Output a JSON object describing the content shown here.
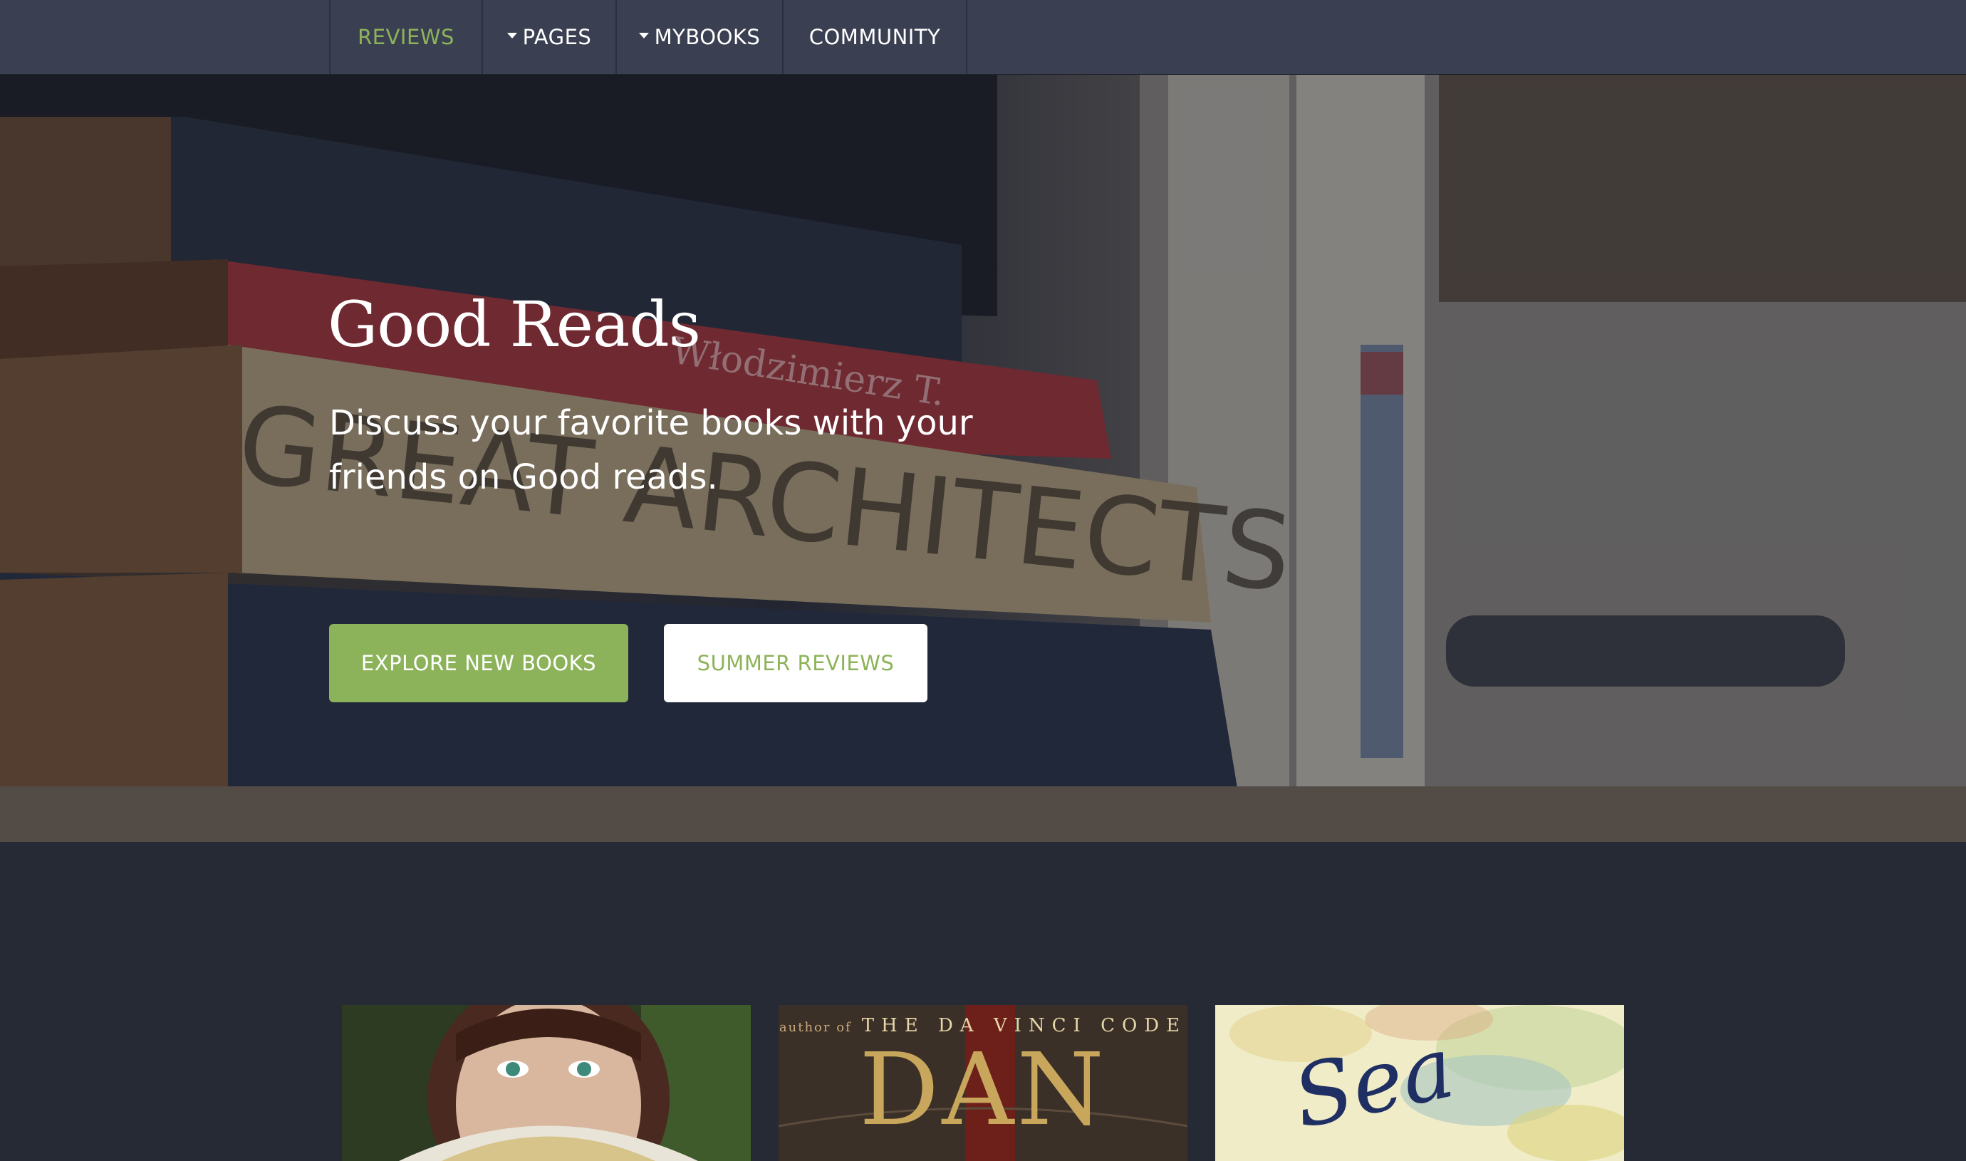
{
  "nav": {
    "items": [
      {
        "label": "REVIEWS",
        "active": true,
        "dropdown": false
      },
      {
        "label": "PAGES",
        "active": false,
        "dropdown": true
      },
      {
        "label": "MYBOOKS",
        "active": false,
        "dropdown": true
      },
      {
        "label": "COMMUNITY",
        "active": false,
        "dropdown": false
      }
    ]
  },
  "hero": {
    "title": "Good Reads",
    "subtitle": "Discuss your favorite books with your friends on Good reads.",
    "primary_button": "EXPLORE NEW BOOKS",
    "secondary_button": "SUMMER REVIEWS",
    "background_spine_text_1": "GREAT ARCHITECTS",
    "background_spine_text_2": "Włodzimierz T."
  },
  "books": [
    {
      "cover": "portrait-with-lace-fan"
    },
    {
      "cover_top_small": "author of",
      "cover_top": "THE DA VINCI CODE",
      "cover_author": "DAN"
    },
    {
      "cover_script": "Sea"
    }
  ],
  "colors": {
    "accent": "#8db35a",
    "nav_bg": "#3a4052",
    "page_bg": "#252a35",
    "text_light": "#ffffff"
  }
}
